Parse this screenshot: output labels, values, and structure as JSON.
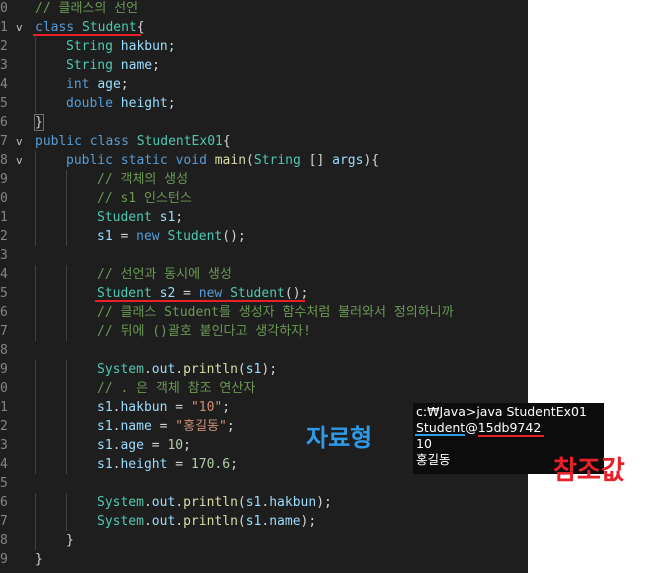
{
  "editor": {
    "lines": [
      {
        "ln": "0",
        "fold": "",
        "indent": 0,
        "tokens": [
          {
            "c": "c",
            "t": "// 클래스의 선언"
          }
        ]
      },
      {
        "ln": "1",
        "fold": "v",
        "indent": 0,
        "tokens": [
          {
            "c": "k",
            "t": "class"
          },
          {
            "c": "p",
            "t": " "
          },
          {
            "c": "t",
            "t": "Student"
          },
          {
            "c": "p",
            "t": "{"
          }
        ]
      },
      {
        "ln": "2",
        "fold": "",
        "indent": 1,
        "tokens": [
          {
            "c": "t",
            "t": "String"
          },
          {
            "c": "p",
            "t": " "
          },
          {
            "c": "v",
            "t": "hakbun"
          },
          {
            "c": "p",
            "t": ";"
          }
        ]
      },
      {
        "ln": "3",
        "fold": "",
        "indent": 1,
        "tokens": [
          {
            "c": "t",
            "t": "String"
          },
          {
            "c": "p",
            "t": " "
          },
          {
            "c": "v",
            "t": "name"
          },
          {
            "c": "p",
            "t": ";"
          }
        ]
      },
      {
        "ln": "4",
        "fold": "",
        "indent": 1,
        "tokens": [
          {
            "c": "k",
            "t": "int"
          },
          {
            "c": "p",
            "t": " "
          },
          {
            "c": "v",
            "t": "age"
          },
          {
            "c": "p",
            "t": ";"
          }
        ]
      },
      {
        "ln": "5",
        "fold": "",
        "indent": 1,
        "tokens": [
          {
            "c": "k",
            "t": "double"
          },
          {
            "c": "p",
            "t": " "
          },
          {
            "c": "v",
            "t": "height"
          },
          {
            "c": "p",
            "t": ";"
          }
        ]
      },
      {
        "ln": "6",
        "fold": "",
        "indent": 0,
        "tokens": [
          {
            "c": "p cur",
            "t": "}"
          }
        ]
      },
      {
        "ln": "7",
        "fold": "v",
        "indent": 0,
        "tokens": [
          {
            "c": "k",
            "t": "public"
          },
          {
            "c": "p",
            "t": " "
          },
          {
            "c": "k",
            "t": "class"
          },
          {
            "c": "p",
            "t": " "
          },
          {
            "c": "t",
            "t": "StudentEx01"
          },
          {
            "c": "p",
            "t": "{"
          }
        ]
      },
      {
        "ln": "8",
        "fold": "v",
        "indent": 1,
        "tokens": [
          {
            "c": "k",
            "t": "public"
          },
          {
            "c": "p",
            "t": " "
          },
          {
            "c": "k",
            "t": "static"
          },
          {
            "c": "p",
            "t": " "
          },
          {
            "c": "k",
            "t": "void"
          },
          {
            "c": "p",
            "t": " "
          },
          {
            "c": "f",
            "t": "main"
          },
          {
            "c": "p",
            "t": "("
          },
          {
            "c": "t",
            "t": "String"
          },
          {
            "c": "p",
            "t": " [] "
          },
          {
            "c": "v",
            "t": "args"
          },
          {
            "c": "p",
            "t": "){"
          }
        ]
      },
      {
        "ln": "9",
        "fold": "",
        "indent": 2,
        "tokens": [
          {
            "c": "c",
            "t": "// 객체의 생성"
          }
        ]
      },
      {
        "ln": "0",
        "fold": "",
        "indent": 2,
        "tokens": [
          {
            "c": "c",
            "t": "// s1 인스턴스"
          }
        ]
      },
      {
        "ln": "1",
        "fold": "",
        "indent": 2,
        "tokens": [
          {
            "c": "t",
            "t": "Student"
          },
          {
            "c": "p",
            "t": " "
          },
          {
            "c": "v",
            "t": "s1"
          },
          {
            "c": "p",
            "t": ";"
          }
        ]
      },
      {
        "ln": "2",
        "fold": "",
        "indent": 2,
        "tokens": [
          {
            "c": "v",
            "t": "s1"
          },
          {
            "c": "p",
            "t": " = "
          },
          {
            "c": "k",
            "t": "new"
          },
          {
            "c": "p",
            "t": " "
          },
          {
            "c": "t",
            "t": "Student"
          },
          {
            "c": "p",
            "t": "();"
          }
        ]
      },
      {
        "ln": "3",
        "fold": "",
        "indent": 0,
        "tokens": []
      },
      {
        "ln": "4",
        "fold": "",
        "indent": 2,
        "tokens": [
          {
            "c": "c",
            "t": "// 선언과 동시에 생성"
          }
        ]
      },
      {
        "ln": "5",
        "fold": "",
        "indent": 2,
        "tokens": [
          {
            "c": "t",
            "t": "Student"
          },
          {
            "c": "p",
            "t": " "
          },
          {
            "c": "v",
            "t": "s2"
          },
          {
            "c": "p",
            "t": " = "
          },
          {
            "c": "k",
            "t": "new"
          },
          {
            "c": "p",
            "t": " "
          },
          {
            "c": "t",
            "t": "Student"
          },
          {
            "c": "p",
            "t": "();"
          }
        ]
      },
      {
        "ln": "6",
        "fold": "",
        "indent": 2,
        "tokens": [
          {
            "c": "c",
            "t": "// 클래스 Student를 생성자 함수처럼 불러와서 정의하니까"
          }
        ]
      },
      {
        "ln": "7",
        "fold": "",
        "indent": 2,
        "tokens": [
          {
            "c": "c",
            "t": "// 뒤에 ()괄호 붙인다고 생각하자!"
          }
        ]
      },
      {
        "ln": "8",
        "fold": "",
        "indent": 0,
        "tokens": []
      },
      {
        "ln": "9",
        "fold": "",
        "indent": 2,
        "tokens": [
          {
            "c": "t",
            "t": "System"
          },
          {
            "c": "p",
            "t": "."
          },
          {
            "c": "v",
            "t": "out"
          },
          {
            "c": "p",
            "t": "."
          },
          {
            "c": "f",
            "t": "println"
          },
          {
            "c": "p",
            "t": "("
          },
          {
            "c": "v",
            "t": "s1"
          },
          {
            "c": "p",
            "t": ");"
          }
        ]
      },
      {
        "ln": "0",
        "fold": "",
        "indent": 2,
        "tokens": [
          {
            "c": "c",
            "t": "// . 은 객체 참조 연산자"
          }
        ]
      },
      {
        "ln": "1",
        "fold": "",
        "indent": 2,
        "tokens": [
          {
            "c": "v",
            "t": "s1"
          },
          {
            "c": "p",
            "t": "."
          },
          {
            "c": "v",
            "t": "hakbun"
          },
          {
            "c": "p",
            "t": " = "
          },
          {
            "c": "s",
            "t": "\"10\""
          },
          {
            "c": "p",
            "t": ";"
          }
        ]
      },
      {
        "ln": "2",
        "fold": "",
        "indent": 2,
        "tokens": [
          {
            "c": "v",
            "t": "s1"
          },
          {
            "c": "p",
            "t": "."
          },
          {
            "c": "v",
            "t": "name"
          },
          {
            "c": "p",
            "t": " = "
          },
          {
            "c": "s",
            "t": "\"홍길동\""
          },
          {
            "c": "p",
            "t": ";"
          }
        ]
      },
      {
        "ln": "3",
        "fold": "",
        "indent": 2,
        "tokens": [
          {
            "c": "v",
            "t": "s1"
          },
          {
            "c": "p",
            "t": "."
          },
          {
            "c": "v",
            "t": "age"
          },
          {
            "c": "p",
            "t": " = "
          },
          {
            "c": "n",
            "t": "10"
          },
          {
            "c": "p",
            "t": ";"
          }
        ]
      },
      {
        "ln": "4",
        "fold": "",
        "indent": 2,
        "tokens": [
          {
            "c": "v",
            "t": "s1"
          },
          {
            "c": "p",
            "t": "."
          },
          {
            "c": "v",
            "t": "height"
          },
          {
            "c": "p",
            "t": " = "
          },
          {
            "c": "n",
            "t": "170.6"
          },
          {
            "c": "p",
            "t": ";"
          }
        ]
      },
      {
        "ln": "5",
        "fold": "",
        "indent": 0,
        "tokens": []
      },
      {
        "ln": "6",
        "fold": "",
        "indent": 2,
        "tokens": [
          {
            "c": "t",
            "t": "System"
          },
          {
            "c": "p",
            "t": "."
          },
          {
            "c": "v",
            "t": "out"
          },
          {
            "c": "p",
            "t": "."
          },
          {
            "c": "f",
            "t": "println"
          },
          {
            "c": "p",
            "t": "("
          },
          {
            "c": "v",
            "t": "s1"
          },
          {
            "c": "p",
            "t": "."
          },
          {
            "c": "v",
            "t": "hakbun"
          },
          {
            "c": "p",
            "t": ");"
          }
        ]
      },
      {
        "ln": "7",
        "fold": "",
        "indent": 2,
        "tokens": [
          {
            "c": "t",
            "t": "System"
          },
          {
            "c": "p",
            "t": "."
          },
          {
            "c": "v",
            "t": "out"
          },
          {
            "c": "p",
            "t": "."
          },
          {
            "c": "f",
            "t": "println"
          },
          {
            "c": "p",
            "t": "("
          },
          {
            "c": "v",
            "t": "s1"
          },
          {
            "c": "p",
            "t": "."
          },
          {
            "c": "v",
            "t": "name"
          },
          {
            "c": "p",
            "t": ");"
          }
        ]
      },
      {
        "ln": "8",
        "fold": "",
        "indent": 1,
        "tokens": [
          {
            "c": "p",
            "t": "}"
          }
        ]
      },
      {
        "ln": "9",
        "fold": "",
        "indent": 0,
        "tokens": [
          {
            "c": "p",
            "t": "}"
          }
        ]
      }
    ]
  },
  "console": {
    "lines": [
      "c:₩Java>java StudentEx01",
      "Student@15db9742",
      "10",
      "홍길동"
    ]
  },
  "annotations": {
    "data_type": "자료형",
    "reference_value": "참조값"
  },
  "colors": {
    "editor_bg": "#1e1e1e",
    "comment": "#6a9955",
    "keyword": "#569cd6",
    "type": "#4ec9b0",
    "variable": "#9cdcfe",
    "red_mark": "#e8202a",
    "blue_mark": "#2f9be8"
  }
}
